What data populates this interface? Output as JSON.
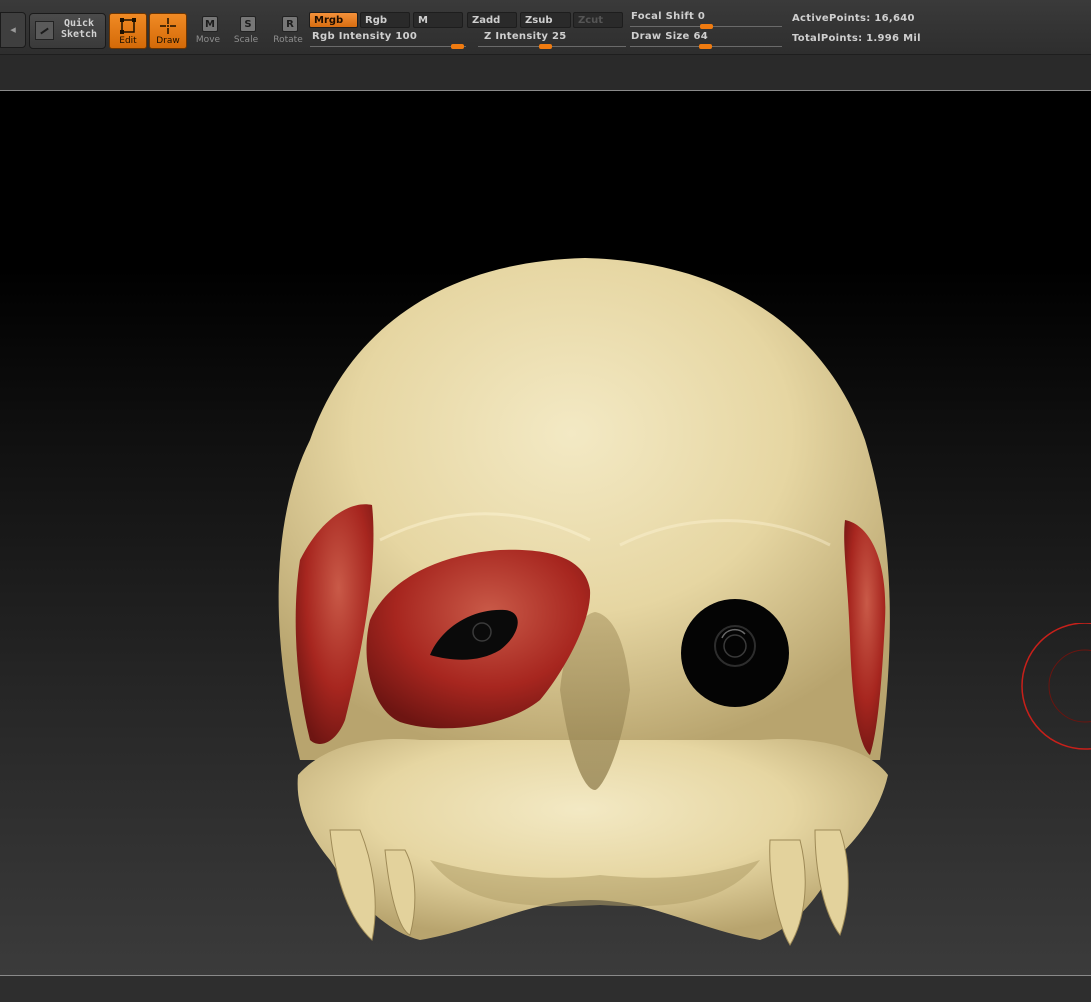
{
  "toolbar": {
    "edge_button_label": "",
    "quick_sketch": {
      "line1": "Quick",
      "line2": "Sketch",
      "icon": "quick-sketch-icon"
    },
    "tools": [
      {
        "key": "edit",
        "label": "Edit",
        "icon": "edit-frame-icon",
        "active": true
      },
      {
        "key": "draw",
        "label": "Draw",
        "icon": "draw-crosshair-icon",
        "active": true
      },
      {
        "key": "move",
        "label": "Move",
        "icon": "move-icon",
        "glyph": "M",
        "active": false
      },
      {
        "key": "scale",
        "label": "Scale",
        "icon": "scale-icon",
        "glyph": "S",
        "active": false
      },
      {
        "key": "rotate",
        "label": "Rotate",
        "icon": "rotate-icon",
        "glyph": "R",
        "active": false
      }
    ],
    "modes": {
      "mrgb": "Mrgb",
      "rgb": "Rgb",
      "m": "M",
      "zadd": "Zadd",
      "zsub": "Zsub",
      "zcut": "Zcut"
    },
    "rgb_intensity": {
      "label": "Rgb  Intensity",
      "value": "100"
    },
    "z_intensity": {
      "label": "Z  Intensity",
      "value": "25"
    },
    "focal_shift": {
      "label": "Focal  Shift",
      "value": "0"
    },
    "draw_size": {
      "label": "Draw  Size",
      "value": "64"
    },
    "stats": {
      "active_points": "ActivePoints: 16,640",
      "total_points": "TotalPoints: 1.996  Mil"
    },
    "accent_color": "#f07b10"
  },
  "viewport": {
    "model": "skull-with-red-muscle-patches",
    "bone_color": "#e6d7a4",
    "muscle_color": "#a7261f",
    "cursor_color": "#c8201a"
  }
}
